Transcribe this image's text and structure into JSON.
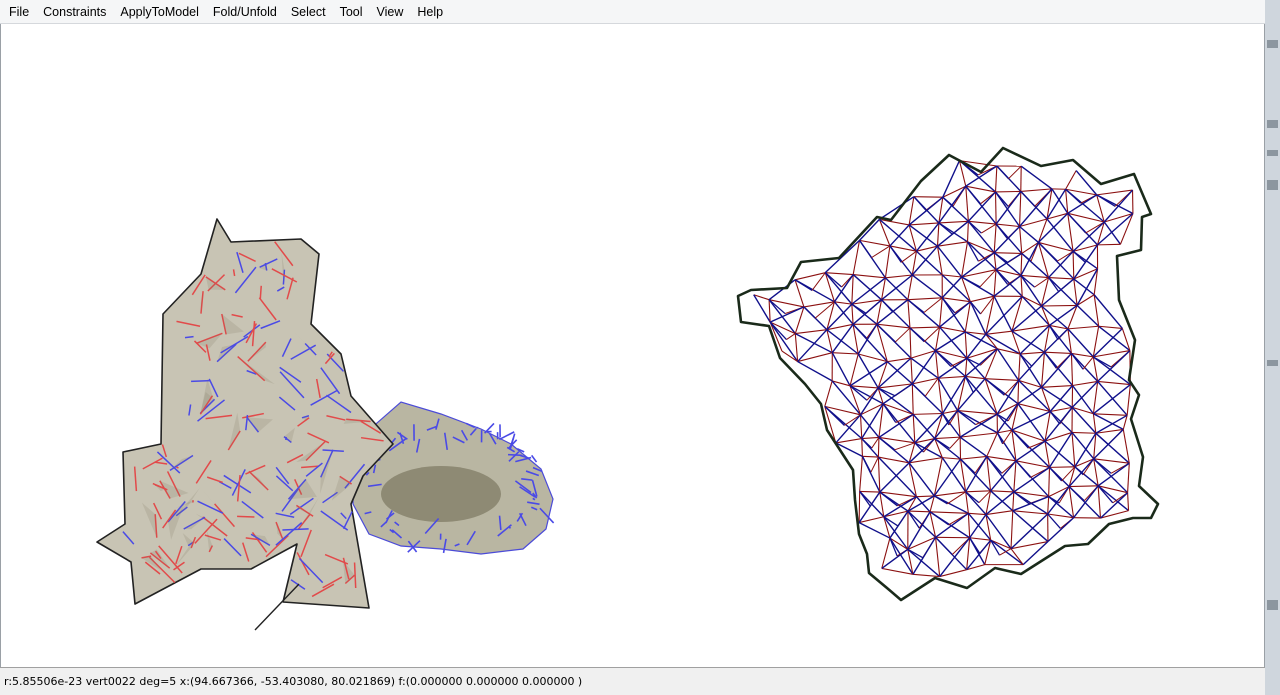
{
  "menubar": {
    "items": [
      {
        "name": "menu-file",
        "label": "File"
      },
      {
        "name": "menu-constraints",
        "label": "Constraints"
      },
      {
        "name": "menu-apply-to-model",
        "label": "ApplyToModel"
      },
      {
        "name": "menu-fold-unfold",
        "label": "Fold/Unfold"
      },
      {
        "name": "menu-select",
        "label": "Select"
      },
      {
        "name": "menu-tool",
        "label": "Tool"
      },
      {
        "name": "menu-view",
        "label": "View"
      },
      {
        "name": "menu-help",
        "label": "Help"
      }
    ]
  },
  "viewport": {
    "folded_model": {
      "fill_color": "#c8c4b4",
      "mountain_color": "#e24a4a",
      "valley_color": "#4a4ae6",
      "edge_color": "#222222"
    },
    "crease_pattern": {
      "mountain_color": "#8b1010",
      "valley_color": "#10108b",
      "border_color": "#1a2a1a"
    }
  },
  "statusbar": {
    "text": "r:5.85506e-23  vert0022 deg=5 x:(94.667366, -53.403080, 80.021869) f:(0.000000 0.000000 0.000000 )"
  }
}
